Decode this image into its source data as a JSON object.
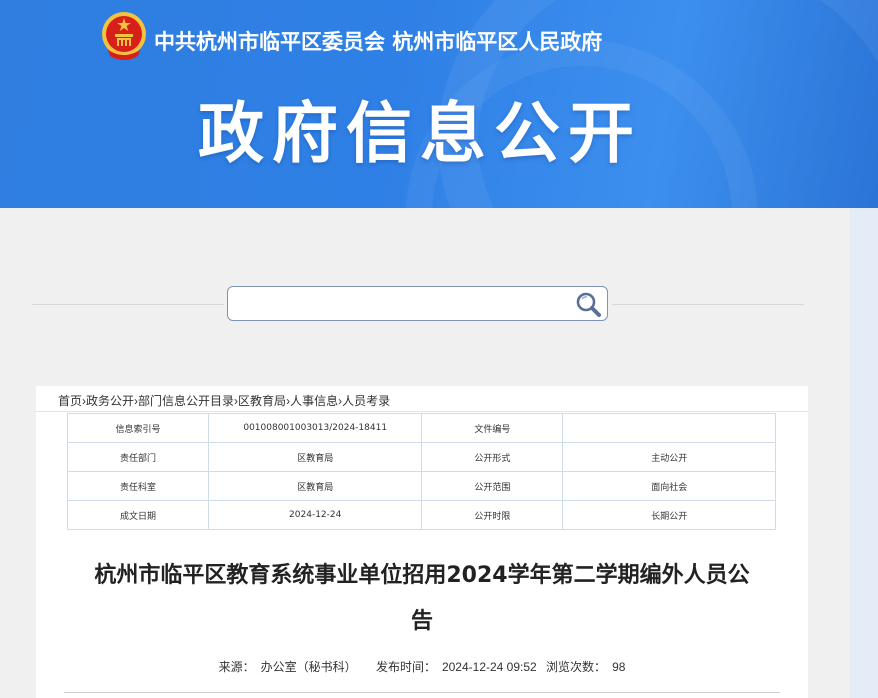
{
  "header": {
    "org_name": "中共杭州市临平区委员会  杭州市临平区人民政府",
    "big_title": "政府信息公开",
    "emblem_icon": "national-emblem-icon",
    "colors": {
      "banner": "#2f80e6",
      "emblem_red": "#d7201a",
      "emblem_gold": "#f3c340"
    }
  },
  "search": {
    "placeholder": "",
    "icon": "search-icon"
  },
  "breadcrumb": [
    "首页",
    "政务公开",
    "部门信息公开目录",
    "区教育局",
    "人事信息",
    "人员考录"
  ],
  "meta_table": {
    "rows": [
      [
        "信息索引号",
        "001008001003013/2024-18411",
        "文件编号",
        ""
      ],
      [
        "责任部门",
        "区教育局",
        "公开形式",
        "主动公开"
      ],
      [
        "责任科室",
        "区教育局",
        "公开范围",
        "面向社会"
      ],
      [
        "成文日期",
        "2024-12-24",
        "公开时限",
        "长期公开"
      ]
    ]
  },
  "article": {
    "title_line1": "杭州市临平区教育系统事业单位招用2024学年第二学期编外人员公",
    "title_line2": "告",
    "source_label": "来源：",
    "source": "办公室（秘书科）",
    "published_label": "发布时间：",
    "published": "2024-12-24 09:52",
    "views_label": "浏览次数：",
    "views": "98"
  }
}
